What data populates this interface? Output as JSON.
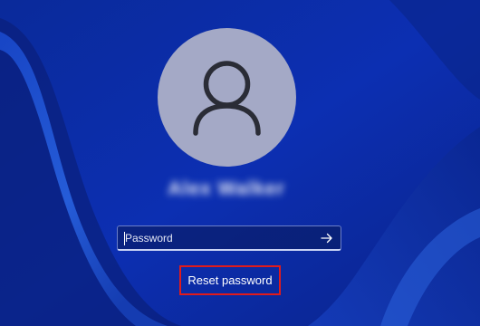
{
  "lock_screen": {
    "username": "Alex Walker",
    "password_placeholder": "Password",
    "reset_password_label": "Reset password"
  },
  "icons": {
    "avatar": "user-silhouette-icon",
    "submit": "arrow-right-icon"
  },
  "colors": {
    "background": "#0b2aa8",
    "avatar_circle": "#a4a9c6",
    "highlight_border": "#e11b1b"
  }
}
